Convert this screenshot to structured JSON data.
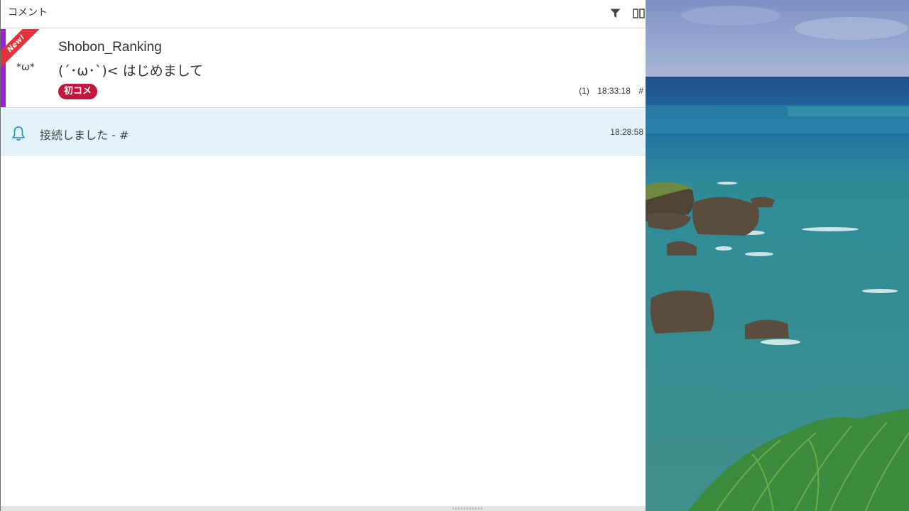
{
  "panel": {
    "title": "コメント",
    "header_icons": [
      "filter-icon",
      "columns-icon"
    ]
  },
  "comment": {
    "ribbon": "New!",
    "avatar": "*ω*",
    "author": "Shobon_Ranking",
    "message": "(´･ω･`)< はじめまして",
    "badge": "初コメ",
    "count": "(1)",
    "time": "18:33:18",
    "hash": "#",
    "accent_color": "#9d1de0",
    "badge_color": "#c3163f"
  },
  "system": {
    "icon": "bell-icon",
    "text": "接続しました - #",
    "time": "18:28:58",
    "bg_color": "#e4f3fa"
  }
}
